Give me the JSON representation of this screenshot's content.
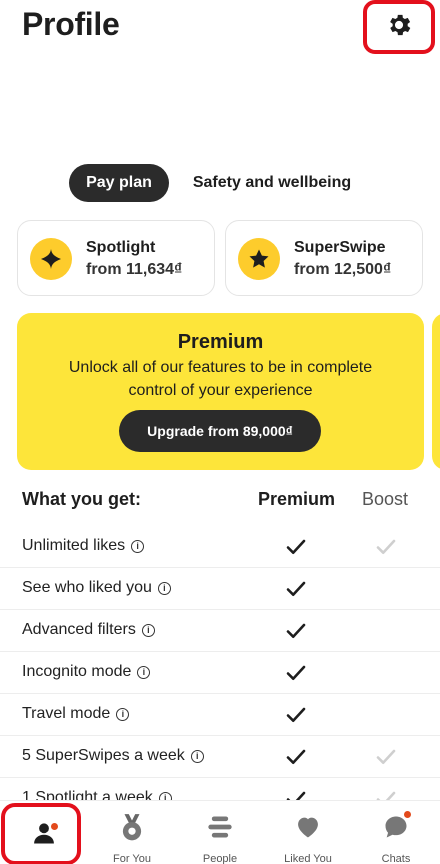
{
  "header": {
    "title": "Profile",
    "settings_icon": "gear-icon"
  },
  "tabs": [
    {
      "label": "Pay plan",
      "active": true
    },
    {
      "label": "Safety and wellbeing",
      "active": false
    }
  ],
  "cards": {
    "spotlight": {
      "title": "Spotlight",
      "price": "from 11,634₫",
      "icon": "sparkle-icon"
    },
    "superswipe": {
      "title": "SuperSwipe",
      "price": "from 12,500₫",
      "icon": "star-icon"
    }
  },
  "premium": {
    "title": "Premium",
    "description": "Unlock all of our features to be in complete control of your experience",
    "button": "Upgrade from 89,000₫"
  },
  "features": {
    "header": {
      "label": "What you get:",
      "col1": "Premium",
      "col2": "Boost"
    },
    "rows": [
      {
        "label": "Unlimited likes",
        "premium": true,
        "boost": true
      },
      {
        "label": "See who liked you",
        "premium": true,
        "boost": false
      },
      {
        "label": "Advanced filters",
        "premium": true,
        "boost": false
      },
      {
        "label": "Incognito mode",
        "premium": true,
        "boost": false
      },
      {
        "label": "Travel mode",
        "premium": true,
        "boost": false
      },
      {
        "label": "5 SuperSwipes a week",
        "premium": true,
        "boost": true
      },
      {
        "label": "1 Spotlight a week",
        "premium": true,
        "boost": true
      }
    ]
  },
  "nav": {
    "items": [
      {
        "label": "",
        "icon": "profile-icon",
        "active": true
      },
      {
        "label": "For You",
        "icon": "medal-icon"
      },
      {
        "label": "People",
        "icon": "stack-icon"
      },
      {
        "label": "Liked You",
        "icon": "heart-icon"
      },
      {
        "label": "Chats",
        "icon": "chat-icon"
      }
    ]
  },
  "colors": {
    "accent": "#fde53a",
    "badge": "#fdcc2c",
    "dark": "#2b2b2b",
    "highlight": "#e3101c"
  }
}
